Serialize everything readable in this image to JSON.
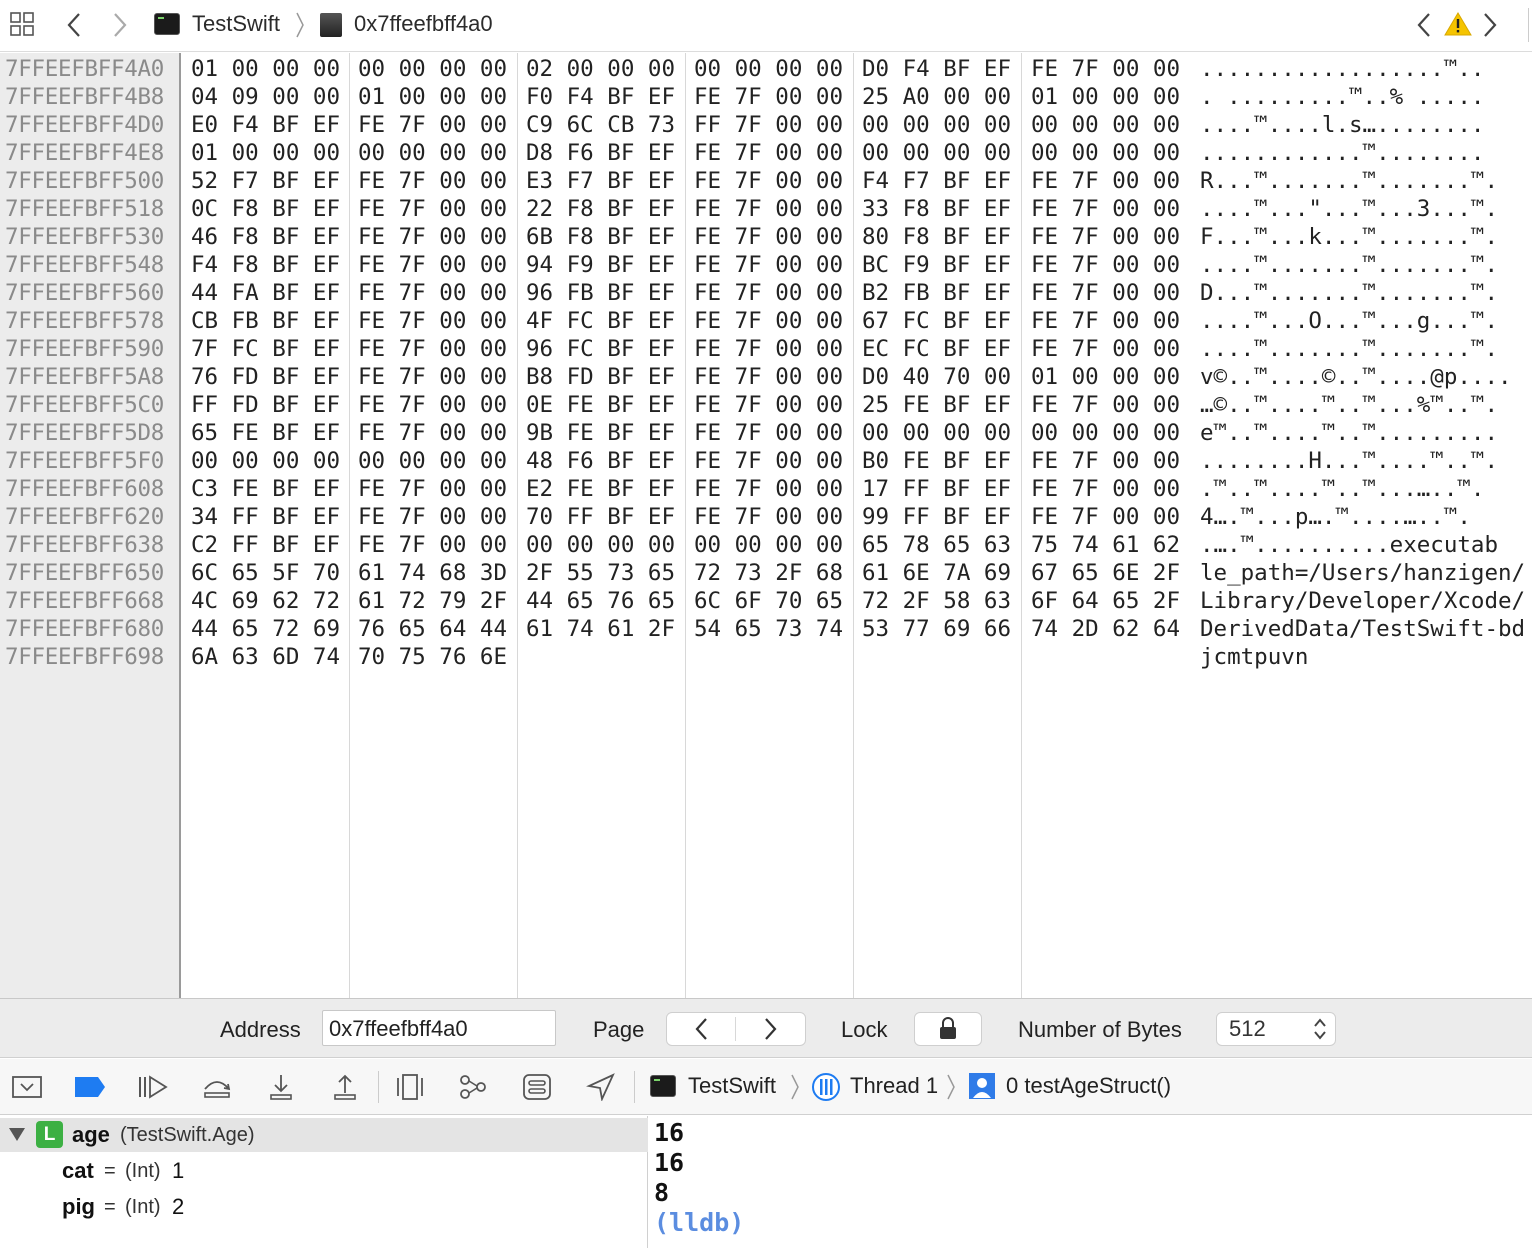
{
  "topbar": {
    "crumb_app": "TestSwift",
    "crumb_address": "0x7ffeefbff4a0"
  },
  "memory": {
    "rows": [
      {
        "addr": "7FFEEFBFF4A0",
        "g": [
          "01 00 00 00",
          "00 00 00 00",
          "02 00 00 00",
          "00 00 00 00",
          "D0 F4 BF EF",
          "FE 7F 00 00"
        ],
        "ascii": "..................™.."
      },
      {
        "addr": "7FFEEFBFF4B8",
        "g": [
          "04 09 00 00",
          "01 00 00 00",
          "F0 F4 BF EF",
          "FE 7F 00 00",
          "25 A0 00 00",
          "01 00 00 00"
        ],
        "ascii": ". .........™..% ....."
      },
      {
        "addr": "7FFEEFBFF4D0",
        "g": [
          "E0 F4 BF EF",
          "FE 7F 00 00",
          "C9 6C CB 73",
          "FF 7F 00 00",
          "00 00 00 00",
          "00 00 00 00"
        ],
        "ascii": "....™....l.s…........"
      },
      {
        "addr": "7FFEEFBFF4E8",
        "g": [
          "01 00 00 00",
          "00 00 00 00",
          "D8 F6 BF EF",
          "FE 7F 00 00",
          "00 00 00 00",
          "00 00 00 00"
        ],
        "ascii": "............™........"
      },
      {
        "addr": "7FFEEFBFF500",
        "g": [
          "52 F7 BF EF",
          "FE 7F 00 00",
          "E3 F7 BF EF",
          "FE 7F 00 00",
          "F4 F7 BF EF",
          "FE 7F 00 00"
        ],
        "ascii": "R...™.......™.......™."
      },
      {
        "addr": "7FFEEFBFF518",
        "g": [
          "0C F8 BF EF",
          "FE 7F 00 00",
          "22 F8 BF EF",
          "FE 7F 00 00",
          "33 F8 BF EF",
          "FE 7F 00 00"
        ],
        "ascii": "....™...\"...™...3...™."
      },
      {
        "addr": "7FFEEFBFF530",
        "g": [
          "46 F8 BF EF",
          "FE 7F 00 00",
          "6B F8 BF EF",
          "FE 7F 00 00",
          "80 F8 BF EF",
          "FE 7F 00 00"
        ],
        "ascii": "F...™...k...™.......™."
      },
      {
        "addr": "7FFEEFBFF548",
        "g": [
          "F4 F8 BF EF",
          "FE 7F 00 00",
          "94 F9 BF EF",
          "FE 7F 00 00",
          "BC F9 BF EF",
          "FE 7F 00 00"
        ],
        "ascii": "....™.......™.......™."
      },
      {
        "addr": "7FFEEFBFF560",
        "g": [
          "44 FA BF EF",
          "FE 7F 00 00",
          "96 FB BF EF",
          "FE 7F 00 00",
          "B2 FB BF EF",
          "FE 7F 00 00"
        ],
        "ascii": "D...™.......™.......™."
      },
      {
        "addr": "7FFEEFBFF578",
        "g": [
          "CB FB BF EF",
          "FE 7F 00 00",
          "4F FC BF EF",
          "FE 7F 00 00",
          "67 FC BF EF",
          "FE 7F 00 00"
        ],
        "ascii": "....™...O...™...g...™."
      },
      {
        "addr": "7FFEEFBFF590",
        "g": [
          "7F FC BF EF",
          "FE 7F 00 00",
          "96 FC BF EF",
          "FE 7F 00 00",
          "EC FC BF EF",
          "FE 7F 00 00"
        ],
        "ascii": "....™.......™.......™."
      },
      {
        "addr": "7FFEEFBFF5A8",
        "g": [
          "76 FD BF EF",
          "FE 7F 00 00",
          "B8 FD BF EF",
          "FE 7F 00 00",
          "D0 40 70 00",
          "01 00 00 00"
        ],
        "ascii": "v©..™....©..™....@p...."
      },
      {
        "addr": "7FFEEFBFF5C0",
        "g": [
          "FF FD BF EF",
          "FE 7F 00 00",
          "0E FE BF EF",
          "FE 7F 00 00",
          "25 FE BF EF",
          "FE 7F 00 00"
        ],
        "ascii": "…©..™....™..™...%™..™."
      },
      {
        "addr": "7FFEEFBFF5D8",
        "g": [
          "65 FE BF EF",
          "FE 7F 00 00",
          "9B FE BF EF",
          "FE 7F 00 00",
          "00 00 00 00",
          "00 00 00 00"
        ],
        "ascii": "e™..™....™..™........."
      },
      {
        "addr": "7FFEEFBFF5F0",
        "g": [
          "00 00 00 00",
          "00 00 00 00",
          "48 F6 BF EF",
          "FE 7F 00 00",
          "B0 FE BF EF",
          "FE 7F 00 00"
        ],
        "ascii": "........H...™....™..™."
      },
      {
        "addr": "7FFEEFBFF608",
        "g": [
          "C3 FE BF EF",
          "FE 7F 00 00",
          "E2 FE BF EF",
          "FE 7F 00 00",
          "17 FF BF EF",
          "FE 7F 00 00"
        ],
        "ascii": ".™..™....™..™...…..™."
      },
      {
        "addr": "7FFEEFBFF620",
        "g": [
          "34 FF BF EF",
          "FE 7F 00 00",
          "70 FF BF EF",
          "FE 7F 00 00",
          "99 FF BF EF",
          "FE 7F 00 00"
        ],
        "ascii": "4….™...p….™....…..™."
      },
      {
        "addr": "7FFEEFBFF638",
        "g": [
          "C2 FF BF EF",
          "FE 7F 00 00",
          "00 00 00 00",
          "00 00 00 00",
          "65 78 65 63",
          "75 74 61 62"
        ],
        "ascii": ".….™..........executab"
      },
      {
        "addr": "7FFEEFBFF650",
        "g": [
          "6C 65 5F 70",
          "61 74 68 3D",
          "2F 55 73 65",
          "72 73 2F 68",
          "61 6E 7A 69",
          "67 65 6E 2F"
        ],
        "ascii": "le_path=/Users/hanzigen/"
      },
      {
        "addr": "7FFEEFBFF668",
        "g": [
          "4C 69 62 72",
          "61 72 79 2F",
          "44 65 76 65",
          "6C 6F 70 65",
          "72 2F 58 63",
          "6F 64 65 2F"
        ],
        "ascii": "Library/Developer/Xcode/"
      },
      {
        "addr": "7FFEEFBFF680",
        "g": [
          "44 65 72 69",
          "76 65 64 44",
          "61 74 61 2F",
          "54 65 73 74",
          "53 77 69 66",
          "74 2D 62 64"
        ],
        "ascii": "DerivedData/TestSwift-bd"
      },
      {
        "addr": "7FFEEFBFF698",
        "g": [
          "6A 63 6D 74",
          "70 75 76 6E",
          "",
          "",
          "",
          ""
        ],
        "ascii": "jcmtpuvn"
      }
    ]
  },
  "controls": {
    "address_label": "Address",
    "address_value": "0x7ffeefbff4a0",
    "page_label": "Page",
    "lock_label": "Lock",
    "bytes_label": "Number of Bytes",
    "bytes_value": "512"
  },
  "debugbar": {
    "crumb_app": "TestSwift",
    "crumb_thread": "Thread 1",
    "crumb_frame": "0 testAgeStruct()"
  },
  "variables": {
    "root_badge": "L",
    "root_name": "age",
    "root_type": "(TestSwift.Age)",
    "children": [
      {
        "name": "cat",
        "eq": "=",
        "type": "(Int)",
        "value": "1"
      },
      {
        "name": "pig",
        "eq": "=",
        "type": "(Int)",
        "value": "2"
      }
    ]
  },
  "console": {
    "lines": [
      "16",
      "16",
      "8"
    ],
    "prompt": "(lldb)",
    "prompt_color": "#5b8de0"
  },
  "colors": {
    "warning": "#f5c400",
    "accent": "#1e7cf2"
  }
}
